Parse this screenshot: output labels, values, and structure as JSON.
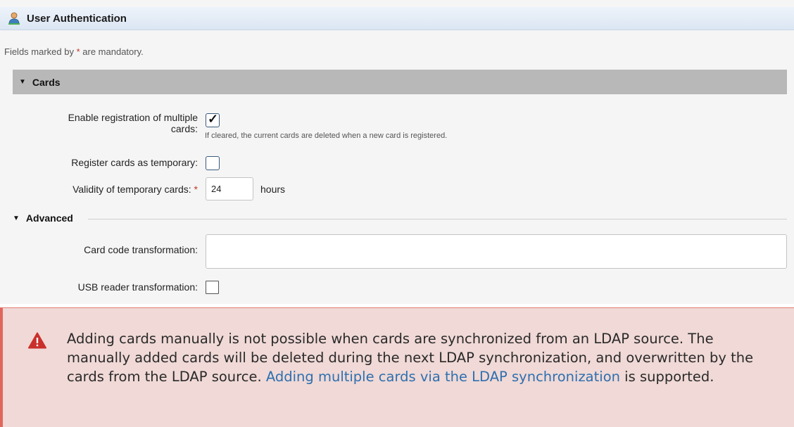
{
  "header": {
    "title": "User Authentication",
    "icon": "user-icon"
  },
  "form": {
    "mandatory_prefix": "Fields marked by ",
    "mandatory_asterisk": "*",
    "mandatory_suffix": " are mandatory.",
    "cards_section": {
      "label": "Cards",
      "expanded": true,
      "enable_multiple": {
        "label_line1": "Enable registration of multiple",
        "label_line2": "cards:",
        "checked": true,
        "hint": "If cleared, the current cards are deleted when a new card is registered."
      },
      "register_temporary": {
        "label": "Register cards as temporary:",
        "checked": false
      },
      "validity": {
        "label": "Validity of temporary cards:",
        "required_mark": "*",
        "value": "24",
        "unit": "hours"
      }
    },
    "advanced_section": {
      "label": "Advanced",
      "expanded": true,
      "card_code_transformation": {
        "label": "Card code transformation:",
        "value": ""
      },
      "usb_reader_transformation": {
        "label": "USB reader transformation:",
        "checked": false
      }
    }
  },
  "warning": {
    "text": "Adding cards manually is not possible when cards are synchronized from an LDAP source. The manually added cards will be deleted during the next LDAP synchronization, and overwritten by the cards from the LDAP source.",
    "link_text": "Adding multiple cards via the LDAP synchronization",
    "suffix": " is supported.",
    "icon": "warning-icon",
    "colors": {
      "background": "#f0d9d6",
      "border": "#e0665c",
      "link": "#2e6fb0",
      "icon": "#c9302c"
    }
  }
}
